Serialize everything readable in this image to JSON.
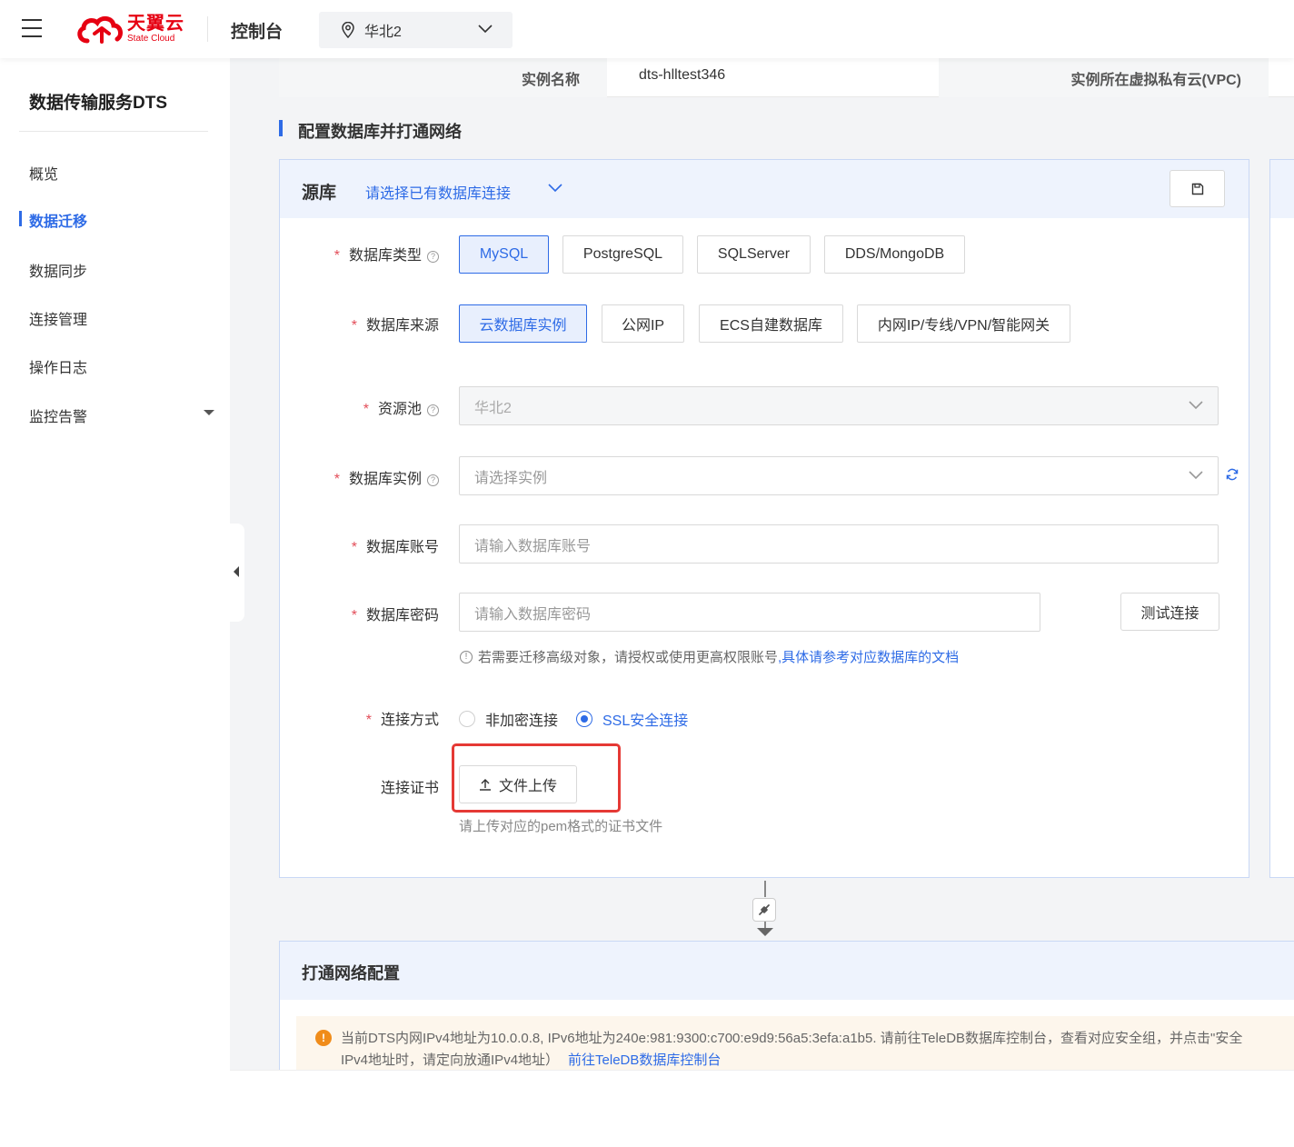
{
  "topbar": {
    "logo_cn": "天翼云",
    "logo_en": "State Cloud",
    "console_title": "控制台",
    "region": "华北2"
  },
  "sidebar": {
    "service_title": "数据传输服务DTS",
    "items": [
      {
        "label": "概览"
      },
      {
        "label": "数据迁移",
        "active": true
      },
      {
        "label": "数据同步"
      },
      {
        "label": "连接管理"
      },
      {
        "label": "操作日志"
      },
      {
        "label": "监控告警",
        "has_dropdown": true
      }
    ]
  },
  "instance_info": {
    "name_label": "实例名称",
    "name_value": "dts-hlltest346",
    "vpc_label": "实例所在虚拟私有云(VPC)"
  },
  "section_title": "配置数据库并打通网络",
  "source": {
    "title": "源库",
    "select_link": "请选择已有数据库连接",
    "db_type": {
      "label": "数据库类型",
      "options": [
        "MySQL",
        "PostgreSQL",
        "SQLServer",
        "DDS/MongoDB"
      ],
      "selected": "MySQL"
    },
    "db_source": {
      "label": "数据库来源",
      "options": [
        "云数据库实例",
        "公网IP",
        "ECS自建数据库",
        "内网IP/专线/VPN/智能网关"
      ],
      "selected": "云数据库实例"
    },
    "resource_pool": {
      "label": "资源池",
      "value": "华北2"
    },
    "db_instance": {
      "label": "数据库实例",
      "placeholder": "请选择实例"
    },
    "db_account": {
      "label": "数据库账号",
      "placeholder": "请输入数据库账号"
    },
    "db_password": {
      "label": "数据库密码",
      "placeholder": "请输入数据库密码"
    },
    "test_button": "测试连接",
    "hint_text": "若需要迁移高级对象，请授权或使用更高权限账号",
    "hint_link": ",具体请参考对应数据库的文档",
    "connection": {
      "label": "连接方式",
      "options": [
        "非加密连接",
        "SSL安全连接"
      ],
      "selected": "SSL安全连接"
    },
    "certificate": {
      "label": "连接证书",
      "upload_button": "文件上传",
      "hint": "请上传对应的pem格式的证书文件"
    }
  },
  "network": {
    "title": "打通网络配置",
    "alert_line1": "当前DTS内网IPv4地址为10.0.0.8, IPv6地址为240e:981:9300:c700:e9d9:56a5:3efa:a1b5. 请前往TeleDB数据库控制台，查看对应安全组，并点击\"安全",
    "alert_line2": "IPv4地址时，请定向放通IPv4地址）",
    "alert_link": "前往TeleDB数据库控制台"
  },
  "colors": {
    "primary": "#2e6be6",
    "brand_red": "#e60012",
    "required": "#e34d59",
    "highlight": "#e53935",
    "warning": "#f08c1a"
  }
}
